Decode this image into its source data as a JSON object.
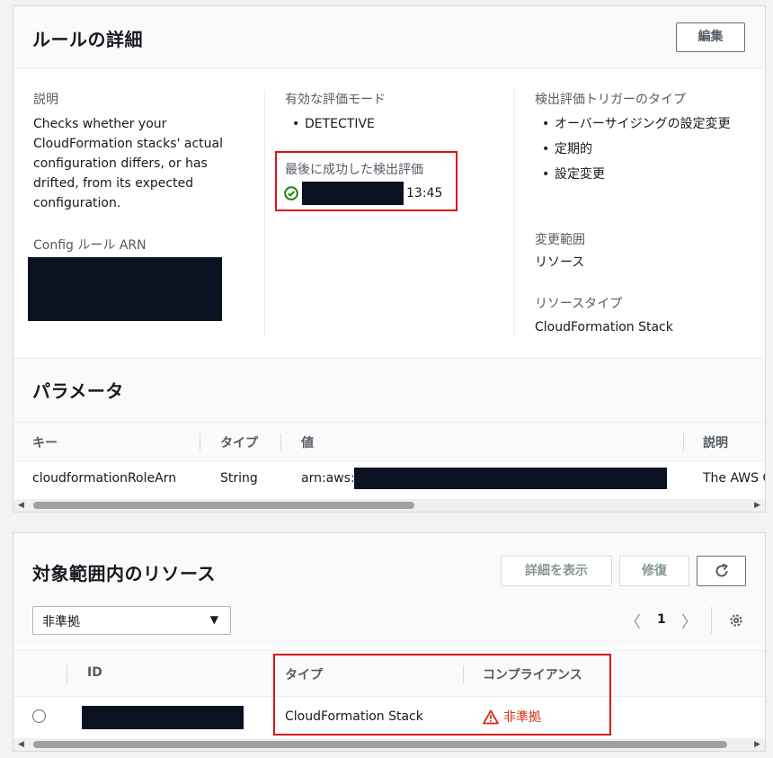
{
  "rule_details": {
    "title": "ルールの詳細",
    "edit_button": "編集",
    "description_label": "説明",
    "description_text": "Checks whether your CloudFormation stacks' actual configuration differs, or has drifted, from its expected configuration.",
    "arn_label": "Config ルール ARN",
    "eval_mode_label": "有効な評価モード",
    "eval_mode_value": "DETECTIVE",
    "last_eval_label": "最後に成功した検出評価",
    "last_eval_time": "13:45",
    "trigger_label": "検出評価トリガーのタイプ",
    "triggers": [
      "オーバーサイジングの設定変更",
      "定期的",
      "設定変更"
    ],
    "scope_label": "変更範囲",
    "scope_value": "リソース",
    "resource_type_label": "リソースタイプ",
    "resource_type_value": "CloudFormation Stack"
  },
  "parameters": {
    "title": "パラメータ",
    "columns": [
      "キー",
      "タイプ",
      "値",
      "説明"
    ],
    "row": {
      "key": "cloudformationRoleArn",
      "type": "String",
      "value_prefix": "arn:aws:",
      "description": "The AWS C"
    }
  },
  "resources": {
    "title": "対象範囲内のリソース",
    "details_button": "詳細を表示",
    "remediate_button": "修復",
    "filter_value": "非準拠",
    "page": "1",
    "columns": [
      "ID",
      "タイプ",
      "コンプライアンス"
    ],
    "row": {
      "type": "CloudFormation Stack",
      "compliance": "非準拠"
    }
  },
  "colors": {
    "success": "#1d8102",
    "error": "#d13212",
    "redaction": "#0a1221",
    "highlight": "#d91515"
  }
}
